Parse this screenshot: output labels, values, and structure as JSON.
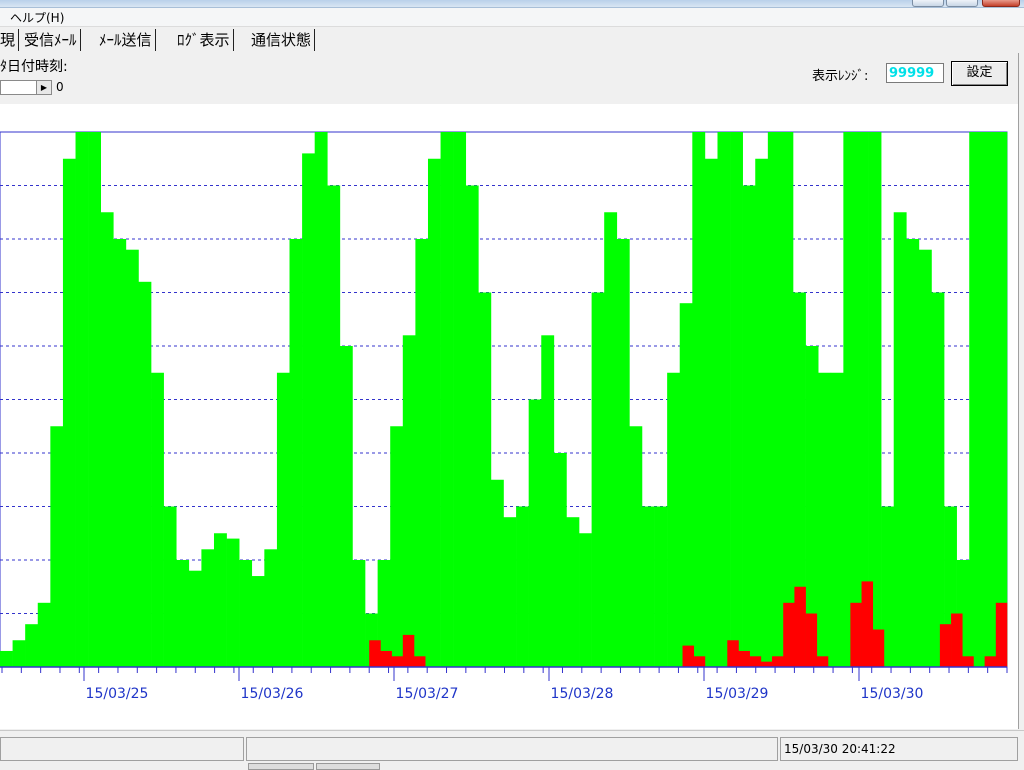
{
  "menu": {
    "help_label": "ヘルプ(H)"
  },
  "tabs": [
    {
      "label": "現"
    },
    {
      "label": "受信ﾒｰﾙ"
    },
    {
      "label": "ﾒｰﾙ送信"
    },
    {
      "label": "ﾛｸﾞ表示"
    },
    {
      "label": "通信状態"
    }
  ],
  "controls": {
    "date_time_label": "ﾀ日付時刻:",
    "scroll_value": "0",
    "range_label": "表示ﾚﾝｼﾞ:",
    "range_value": "99999",
    "set_button_label": "設定"
  },
  "chart_data": {
    "type": "bar",
    "title": "",
    "xlabel": "",
    "ylabel": "",
    "x_tick_labels": [
      "15/03/25",
      "15/03/26",
      "15/03/27",
      "15/03/28",
      "15/03/29",
      "15/03/30"
    ],
    "y_max_display": 99999,
    "grid": "horizontal dashed",
    "colors": {
      "received": "#00ff00",
      "error": "#ff0000",
      "axis": "#3333cc",
      "grid": "#3333cc"
    },
    "series": [
      {
        "color": "green",
        "values": [
          0.03,
          0.05,
          0.08,
          0.12,
          0.45,
          0.95,
          1.0,
          1.0,
          0.85,
          0.8,
          0.78,
          0.72,
          0.55,
          0.3,
          0.2,
          0.18,
          0.22,
          0.25,
          0.24,
          0.2,
          0.17,
          0.22,
          0.55,
          0.8,
          0.96,
          1.0,
          0.9,
          0.6,
          0.2,
          0.1,
          0.2,
          0.45,
          0.62,
          0.8,
          0.95,
          1.0,
          1.0,
          0.9,
          0.7,
          0.35,
          0.28,
          0.3,
          0.5,
          0.62,
          0.4,
          0.28,
          0.25,
          0.7,
          0.85,
          0.8,
          0.45,
          0.3,
          0.3,
          0.55,
          0.68,
          1.0,
          0.95,
          1.0,
          1.0,
          0.9,
          0.95,
          1.0,
          1.0,
          0.7,
          0.6,
          0.55,
          0.55,
          1.0,
          1.0,
          1.0,
          0.3,
          0.85,
          0.8,
          0.78,
          0.7,
          0.3,
          0.2,
          1.0,
          1.0,
          1.0
        ]
      },
      {
        "color": "red",
        "values": [
          0,
          0,
          0,
          0,
          0,
          0,
          0,
          0,
          0,
          0,
          0,
          0,
          0,
          0,
          0,
          0,
          0,
          0,
          0,
          0,
          0,
          0,
          0,
          0,
          0,
          0,
          0,
          0,
          0,
          0,
          0,
          0,
          0,
          0.05,
          0.03,
          0.02,
          0.06,
          0.02,
          0,
          0,
          0,
          0,
          0,
          0,
          0,
          0,
          0,
          0,
          0,
          0,
          0,
          0,
          0,
          0,
          0,
          0,
          0,
          0,
          0,
          0,
          0,
          0.04,
          0.02,
          0,
          0,
          0.05,
          0.03,
          0.02,
          0.01,
          0.02,
          0.12,
          0.15,
          0.1,
          0.02,
          0,
          0,
          0.12,
          0.16,
          0.07,
          0,
          0,
          0,
          0,
          0,
          0.08,
          0.1,
          0.02,
          0,
          0.02,
          0.12
        ]
      }
    ]
  },
  "statusbar": {
    "timestamp": "15/03/30 20:41:22"
  }
}
